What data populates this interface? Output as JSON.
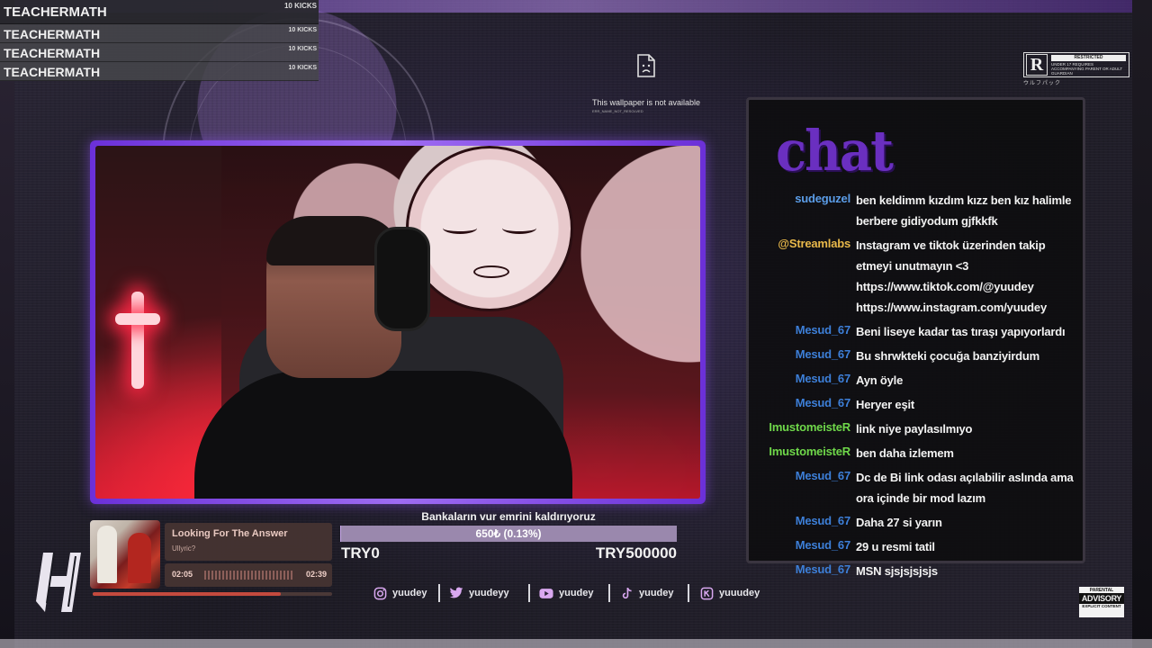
{
  "kicks": [
    {
      "name": "TEACHERMATH",
      "count": "10 KICKS"
    },
    {
      "name": "TEACHERMATH",
      "count": "10 KICKS"
    },
    {
      "name": "TEACHERMATH",
      "count": "10 KICKS"
    },
    {
      "name": "TEACHERMATH",
      "count": "10 KICKS"
    }
  ],
  "wallpaper": {
    "message": "This wallpaper is not available",
    "error_code": "ERR_NAME_NOT_RESOLVED",
    "icon": "broken-page-icon"
  },
  "rating": {
    "letter": "R",
    "title": "RESTRICTED",
    "description": "UNDER 17 REQUIRES ACCOMPANYING PARENT OR ADULT GUARDIAN",
    "subtitle": "ウルフパック"
  },
  "chat": {
    "logo": "chat",
    "messages": [
      {
        "user": "sudeguzel",
        "color": "#5b9de8",
        "text": "ben keldimm kızdım kızz ben kız halimle berbere gidiyodum gjfkkfk"
      },
      {
        "user": "@Streamlabs",
        "color": "#e8b84a",
        "text": "Instagram ve tiktok üzerinden takip etmeyi unutmayın <3 https://www.tiktok.com/@yuudey https://www.instagram.com/yuudey"
      },
      {
        "user": "Mesud_67",
        "color": "#3d7fd8",
        "text": "Beni liseye kadar tas tıraşı yapıyorlardı"
      },
      {
        "user": "Mesud_67",
        "color": "#3d7fd8",
        "text": "Bu shrwkteki çocuğa banziyirdum"
      },
      {
        "user": "Mesud_67",
        "color": "#3d7fd8",
        "text": "Ayn öyle"
      },
      {
        "user": "Mesud_67",
        "color": "#3d7fd8",
        "text": "Heryer eşit"
      },
      {
        "user": "ImustomeisteR",
        "color": "#6fd84a",
        "text": "link niye paylasılmıyo"
      },
      {
        "user": "ImustomeisteR",
        "color": "#6fd84a",
        "text": "ben daha izlemem"
      },
      {
        "user": "Mesud_67",
        "color": "#3d7fd8",
        "text": "Dc de Bi link odası açılabilir aslında ama ora içinde bir mod lazım"
      },
      {
        "user": "Mesud_67",
        "color": "#3d7fd8",
        "text": "Daha 27 si yarın"
      },
      {
        "user": "Mesud_67",
        "color": "#3d7fd8",
        "text": "29 u resmi tatil"
      },
      {
        "user": "Mesud_67",
        "color": "#3d7fd8",
        "text": "MSN sjsjsjsjsjs"
      }
    ]
  },
  "song": {
    "title": "Looking For The Answer",
    "artist": "Ullyric?",
    "elapsed": "02:05",
    "duration": "02:39",
    "progress": 0.786
  },
  "goal": {
    "title": "Bankaların vur emrini kaldırıyoruz",
    "current_text": "650₺ (0.13%)",
    "progress": 0.0013,
    "min_label": "TRY0",
    "max_label": "TRY500000"
  },
  "socials": [
    {
      "platform": "instagram",
      "icon": "instagram-icon",
      "label": "yuudey"
    },
    {
      "platform": "twitter",
      "icon": "twitter-icon",
      "label": "yuudeyy"
    },
    {
      "platform": "youtube",
      "icon": "youtube-icon",
      "label": "yuudey"
    },
    {
      "platform": "tiktok",
      "icon": "tiktok-icon",
      "label": "yuudey"
    },
    {
      "platform": "kick",
      "icon": "kick-icon",
      "label": "yuuudey"
    }
  ],
  "advisory": {
    "top": "PARENTAL",
    "middle": "ADVISORY",
    "bottom": "EXPLICIT CONTENT"
  },
  "colors": {
    "accent_purple": "#8a4cf0",
    "goal_fill": "#c8a8e8",
    "song_panel": "#46342f"
  }
}
